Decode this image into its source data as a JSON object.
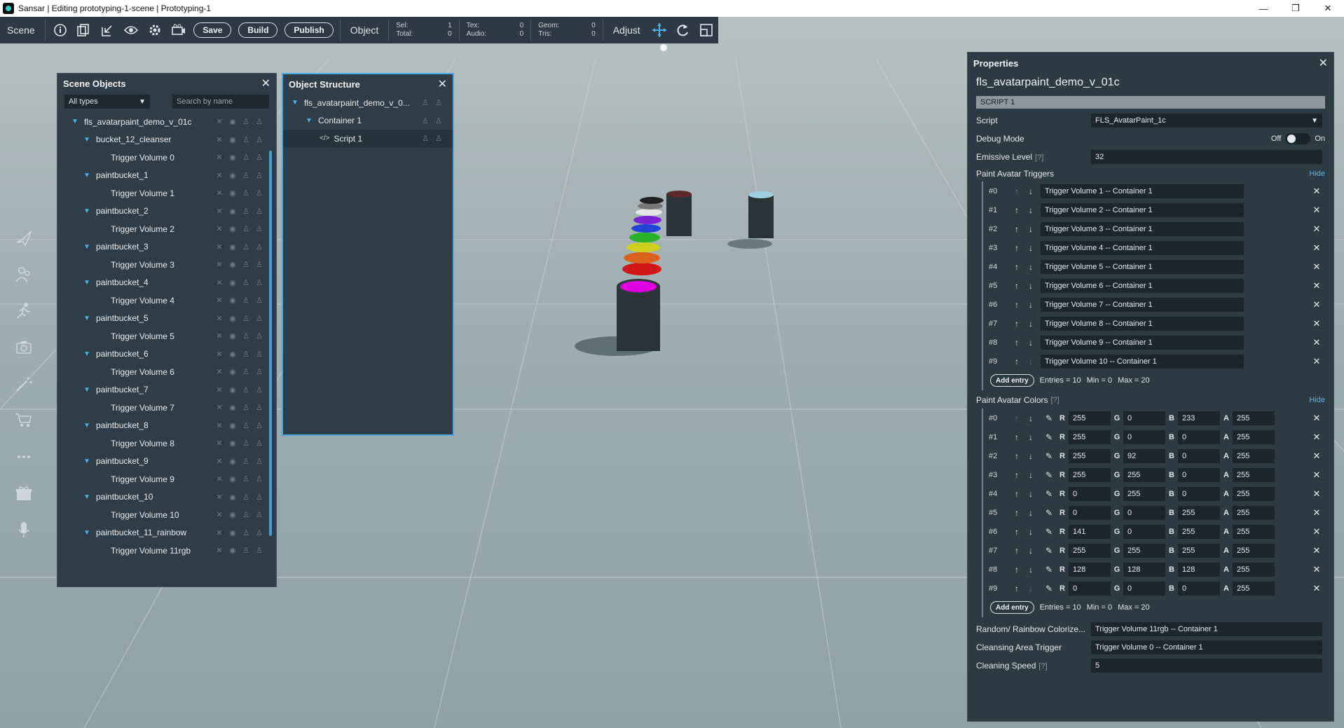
{
  "window": {
    "title": "Sansar | Editing prototyping-1-scene | Prototyping-1",
    "controls": {
      "minimize": "—",
      "maximize": "❐",
      "close": "✕"
    }
  },
  "toolbar": {
    "scene_label": "Scene",
    "save_label": "Save",
    "build_label": "Build",
    "publish_label": "Publish",
    "object_label": "Object",
    "adjust_label": "Adjust",
    "stats": {
      "sel_label": "Sel:",
      "sel_value": "1",
      "total_label": "Total:",
      "total_value": "0",
      "tex_label": "Tex:",
      "tex_value": "0",
      "audio_label": "Audio:",
      "audio_value": "0",
      "geom_label": "Geom:",
      "geom_value": "0",
      "tris_label": "Tris:",
      "tris_value": "0"
    }
  },
  "scene_objects": {
    "title": "Scene Objects",
    "filter": "All types",
    "search_placeholder": "Search by name",
    "items": [
      {
        "label": "fls_avatarpaint_demo_v_01c",
        "depth": 0,
        "expanded": true
      },
      {
        "label": "bucket_12_cleanser",
        "depth": 1,
        "expanded": true
      },
      {
        "label": "Trigger Volume 0",
        "depth": 2,
        "expanded": false
      },
      {
        "label": "paintbucket_1",
        "depth": 1,
        "expanded": true
      },
      {
        "label": "Trigger Volume 1",
        "depth": 2,
        "expanded": false
      },
      {
        "label": "paintbucket_2",
        "depth": 1,
        "expanded": true
      },
      {
        "label": "Trigger Volume 2",
        "depth": 2,
        "expanded": false
      },
      {
        "label": "paintbucket_3",
        "depth": 1,
        "expanded": true
      },
      {
        "label": "Trigger Volume 3",
        "depth": 2,
        "expanded": false
      },
      {
        "label": "paintbucket_4",
        "depth": 1,
        "expanded": true
      },
      {
        "label": "Trigger Volume 4",
        "depth": 2,
        "expanded": false
      },
      {
        "label": "paintbucket_5",
        "depth": 1,
        "expanded": true
      },
      {
        "label": "Trigger Volume 5",
        "depth": 2,
        "expanded": false
      },
      {
        "label": "paintbucket_6",
        "depth": 1,
        "expanded": true
      },
      {
        "label": "Trigger Volume 6",
        "depth": 2,
        "expanded": false
      },
      {
        "label": "paintbucket_7",
        "depth": 1,
        "expanded": true
      },
      {
        "label": "Trigger Volume 7",
        "depth": 2,
        "expanded": false
      },
      {
        "label": "paintbucket_8",
        "depth": 1,
        "expanded": true
      },
      {
        "label": "Trigger Volume 8",
        "depth": 2,
        "expanded": false
      },
      {
        "label": "paintbucket_9",
        "depth": 1,
        "expanded": true
      },
      {
        "label": "Trigger Volume 9",
        "depth": 2,
        "expanded": false
      },
      {
        "label": "paintbucket_10",
        "depth": 1,
        "expanded": true
      },
      {
        "label": "Trigger Volume 10",
        "depth": 2,
        "expanded": false
      },
      {
        "label": "paintbucket_11_rainbow",
        "depth": 1,
        "expanded": true
      },
      {
        "label": "Trigger Volume 11rgb",
        "depth": 2,
        "expanded": false
      }
    ]
  },
  "object_structure": {
    "title": "Object Structure",
    "items": [
      {
        "label": "fls_avatarpaint_demo_v_0...",
        "depth": 0,
        "expanded": true
      },
      {
        "label": "Container 1",
        "depth": 1,
        "expanded": true
      },
      {
        "label": "Script 1",
        "depth": 2,
        "expanded": false,
        "selected": true,
        "code": true
      }
    ]
  },
  "properties": {
    "title": "Properties",
    "object_name": "fls_avatarpaint_demo_v_01c",
    "section": "SCRIPT 1",
    "script_label": "Script",
    "script_value": "FLS_AvatarPaint_1c",
    "debug_label": "Debug Mode",
    "debug_off": "Off",
    "debug_on": "On",
    "emissive_label": "Emissive Level",
    "emissive_value": "32",
    "help_marker": "[?]",
    "hide_label": "Hide",
    "triggers_label": "Paint Avatar Triggers",
    "triggers": [
      {
        "idx": "#0",
        "value": "Trigger Volume 1 -- Container 1"
      },
      {
        "idx": "#1",
        "value": "Trigger Volume 2 -- Container 1"
      },
      {
        "idx": "#2",
        "value": "Trigger Volume 3 -- Container 1"
      },
      {
        "idx": "#3",
        "value": "Trigger Volume 4 -- Container 1"
      },
      {
        "idx": "#4",
        "value": "Trigger Volume 5 -- Container 1"
      },
      {
        "idx": "#5",
        "value": "Trigger Volume 6 -- Container 1"
      },
      {
        "idx": "#6",
        "value": "Trigger Volume 7 -- Container 1"
      },
      {
        "idx": "#7",
        "value": "Trigger Volume 8 -- Container 1"
      },
      {
        "idx": "#8",
        "value": "Trigger Volume 9 -- Container 1"
      },
      {
        "idx": "#9",
        "value": "Trigger Volume 10 -- Container 1"
      }
    ],
    "add_entry_label": "Add entry",
    "entries_info": "Entries = 10",
    "min_info": "Min = 0",
    "max_info": "Max = 20",
    "colors_label": "Paint Avatar Colors",
    "colors": [
      {
        "idx": "#0",
        "r": "255",
        "g": "0",
        "b": "233",
        "a": "255"
      },
      {
        "idx": "#1",
        "r": "255",
        "g": "0",
        "b": "0",
        "a": "255"
      },
      {
        "idx": "#2",
        "r": "255",
        "g": "92",
        "b": "0",
        "a": "255"
      },
      {
        "idx": "#3",
        "r": "255",
        "g": "255",
        "b": "0",
        "a": "255"
      },
      {
        "idx": "#4",
        "r": "0",
        "g": "255",
        "b": "0",
        "a": "255"
      },
      {
        "idx": "#5",
        "r": "0",
        "g": "0",
        "b": "255",
        "a": "255"
      },
      {
        "idx": "#6",
        "r": "141",
        "g": "0",
        "b": "255",
        "a": "255"
      },
      {
        "idx": "#7",
        "r": "255",
        "g": "255",
        "b": "255",
        "a": "255"
      },
      {
        "idx": "#8",
        "r": "128",
        "g": "128",
        "b": "128",
        "a": "255"
      },
      {
        "idx": "#9",
        "r": "0",
        "g": "0",
        "b": "0",
        "a": "255"
      }
    ],
    "rainbow_label": "Random/ Rainbow Colorize...",
    "rainbow_value": "Trigger Volume 11rgb -- Container 1",
    "cleansing_label": "Cleansing Area Trigger",
    "cleansing_value": "Trigger Volume 0 -- Container 1",
    "speed_label": "Cleaning Speed",
    "speed_value": "5"
  },
  "colors": {
    "accent": "#4cb0e6",
    "panel_bg": "#2f3d48",
    "toolbar_bg": "#2d3a45"
  }
}
